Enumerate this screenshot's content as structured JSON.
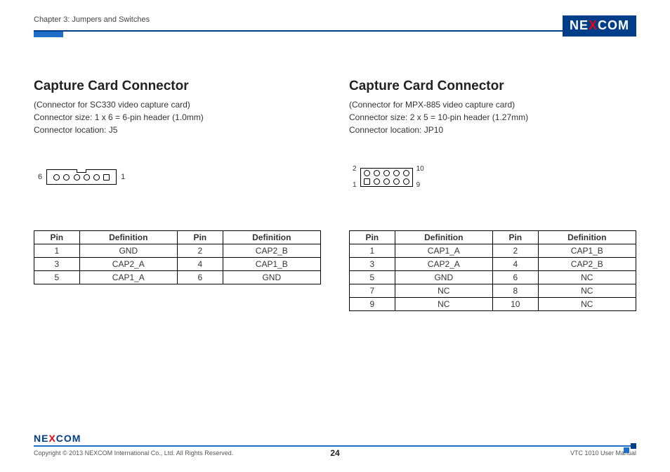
{
  "header": {
    "chapter": "Chapter 3: Jumpers and Switches",
    "brand_pre": "NE",
    "brand_x": "X",
    "brand_post": "COM"
  },
  "left": {
    "title": "Capture Card Connector",
    "sub1": "(Connector for SC330 video capture card)",
    "sub2": "Connector size: 1 x 6 = 6-pin header (1.0mm)",
    "sub3": "Connector location: J5",
    "label_left": "6",
    "label_right": "1",
    "table": {
      "h1": "Pin",
      "h2": "Definition",
      "h3": "Pin",
      "h4": "Definition",
      "rows": [
        {
          "c1": "1",
          "c2": "GND",
          "c3": "2",
          "c4": "CAP2_B"
        },
        {
          "c1": "3",
          "c2": "CAP2_A",
          "c3": "4",
          "c4": "CAP1_B"
        },
        {
          "c1": "5",
          "c2": "CAP1_A",
          "c3": "6",
          "c4": "GND"
        }
      ]
    }
  },
  "right": {
    "title": "Capture Card Connector",
    "sub1": "(Connector for MPX-885 video capture card)",
    "sub2": "Connector size: 2 x 5 = 10-pin header (1.27mm)",
    "sub3": "Connector location: JP10",
    "lt": "2",
    "rt": "10",
    "lb": "1",
    "rb": "9",
    "table": {
      "h1": "Pin",
      "h2": "Definition",
      "h3": "Pin",
      "h4": "Definition",
      "rows": [
        {
          "c1": "1",
          "c2": "CAP1_A",
          "c3": "2",
          "c4": "CAP1_B"
        },
        {
          "c1": "3",
          "c2": "CAP2_A",
          "c3": "4",
          "c4": "CAP2_B"
        },
        {
          "c1": "5",
          "c2": "GND",
          "c3": "6",
          "c4": "NC"
        },
        {
          "c1": "7",
          "c2": "NC",
          "c3": "8",
          "c4": "NC"
        },
        {
          "c1": "9",
          "c2": "NC",
          "c3": "10",
          "c4": "NC"
        }
      ]
    }
  },
  "footer": {
    "brand_pre": "NE",
    "brand_x": "X",
    "brand_post": "COM",
    "copyright": "Copyright © 2013 NEXCOM International Co., Ltd. All Rights Reserved.",
    "page": "24",
    "doc": "VTC 1010 User Manual"
  }
}
